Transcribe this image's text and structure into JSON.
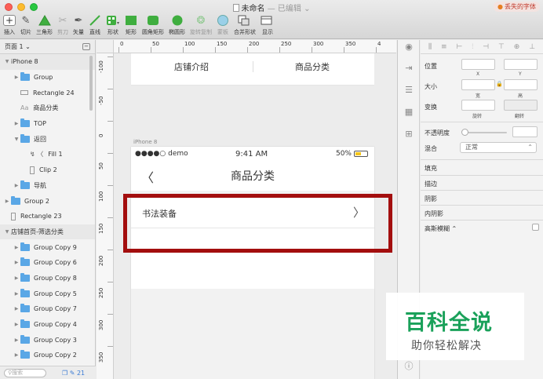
{
  "window": {
    "title": "未命名",
    "edited": "— 已编辑 ⌄",
    "missing_fonts": "丢失的字体"
  },
  "toolbar": {
    "items": [
      {
        "label": "插入",
        "icon": "plus-icon"
      },
      {
        "label": "切片",
        "icon": "knife-icon"
      },
      {
        "label": "三角形",
        "icon": "triangle-icon"
      },
      {
        "label": "剪刀",
        "icon": "scissors-icon"
      },
      {
        "label": "矢量",
        "icon": "pen-icon"
      },
      {
        "label": "直线",
        "icon": "line-icon"
      },
      {
        "label": "形状",
        "icon": "shapes-icon"
      },
      {
        "label": "矩形",
        "icon": "rectangle-icon"
      },
      {
        "label": "圆角矩形",
        "icon": "rounded-rectangle-icon"
      },
      {
        "label": "椭圆形",
        "icon": "oval-icon"
      },
      {
        "label": "旋转复制",
        "icon": "rotate-copy-icon"
      },
      {
        "label": "蒙板",
        "icon": "mask-icon"
      },
      {
        "label": "合并形状",
        "icon": "combine-icon"
      },
      {
        "label": "显示",
        "icon": "view-icon"
      }
    ]
  },
  "pages": {
    "label": "页面 1 ⌄"
  },
  "layers": [
    {
      "name": "iPhone 8",
      "kind": "artboard",
      "indent": 0,
      "arrow": "▼"
    },
    {
      "name": "Group",
      "kind": "folder",
      "indent": 1,
      "arrow": "▶"
    },
    {
      "name": "Rectangle 24",
      "kind": "rect",
      "indent": 1,
      "arrow": ""
    },
    {
      "name": "商品分类",
      "kind": "text",
      "indent": 1,
      "arrow": ""
    },
    {
      "name": "TOP",
      "kind": "folder",
      "indent": 1,
      "arrow": "▶"
    },
    {
      "name": "返回",
      "kind": "folder",
      "indent": 1,
      "arrow": "▼"
    },
    {
      "name": "Fill 1",
      "kind": "path",
      "indent": 2,
      "arrow": ""
    },
    {
      "name": "Clip 2",
      "kind": "tall",
      "indent": 2,
      "arrow": ""
    },
    {
      "name": "导航",
      "kind": "folder",
      "indent": 1,
      "arrow": "▶"
    },
    {
      "name": "Group 2",
      "kind": "folder",
      "indent": 0,
      "arrow": "▶"
    },
    {
      "name": "Rectangle 23",
      "kind": "tall",
      "indent": 0,
      "arrow": ""
    },
    {
      "name": "店铺首页-筛选分类",
      "kind": "artboard",
      "indent": 0,
      "arrow": "▼"
    },
    {
      "name": "Group Copy 9",
      "kind": "folder",
      "indent": 1,
      "arrow": "▶"
    },
    {
      "name": "Group Copy 6",
      "kind": "folder",
      "indent": 1,
      "arrow": "▶"
    },
    {
      "name": "Group Copy 8",
      "kind": "folder",
      "indent": 1,
      "arrow": "▶"
    },
    {
      "name": "Group Copy 5",
      "kind": "folder",
      "indent": 1,
      "arrow": "▶"
    },
    {
      "name": "Group Copy 7",
      "kind": "folder",
      "indent": 1,
      "arrow": "▶"
    },
    {
      "name": "Group Copy 4",
      "kind": "folder",
      "indent": 1,
      "arrow": "▶"
    },
    {
      "name": "Group Copy 3",
      "kind": "folder",
      "indent": 1,
      "arrow": "▶"
    },
    {
      "name": "Group Copy 2",
      "kind": "folder",
      "indent": 1,
      "arrow": "▶"
    }
  ],
  "left_footer": {
    "search_placeholder": "搜索",
    "count": "21"
  },
  "ruler": {
    "h_labels": [
      "0",
      "50",
      "100",
      "150",
      "200",
      "250",
      "300",
      "350",
      "4"
    ],
    "v_labels": [
      "-100",
      "-50",
      "0",
      "50",
      "100",
      "150",
      "200",
      "250",
      "300",
      "350"
    ]
  },
  "artboard_top": {
    "tab_a": "店铺介绍",
    "tab_b": "商品分类"
  },
  "artboard": {
    "label": "iPhone 8",
    "carrier": "●●●●○ demo",
    "time": "9:41 AM",
    "battery": "50%",
    "battery_level": 0.5,
    "back": "〈",
    "title": "商品分类",
    "category": "书法装备",
    "chevron": "〉"
  },
  "inspector": {
    "position": "位置",
    "x": "X",
    "y": "Y",
    "size": "大小",
    "width": "宽",
    "height": "高",
    "transform": "变换",
    "rotate": "旋转",
    "flip": "翻转",
    "opacity": "不透明度",
    "blend": "混合",
    "blend_value": "正常",
    "fill": "填充",
    "border": "描边",
    "shadow": "阴影",
    "inner_shadow": "内阴影",
    "blur": "高斯模糊 ⌃"
  },
  "watermark": {
    "logo": "百科全说",
    "sub": "助你轻松解决"
  },
  "colors": {
    "highlight": "#a30e0e",
    "folder": "#5aa7e6",
    "watermark_green": "#1aa15a"
  }
}
